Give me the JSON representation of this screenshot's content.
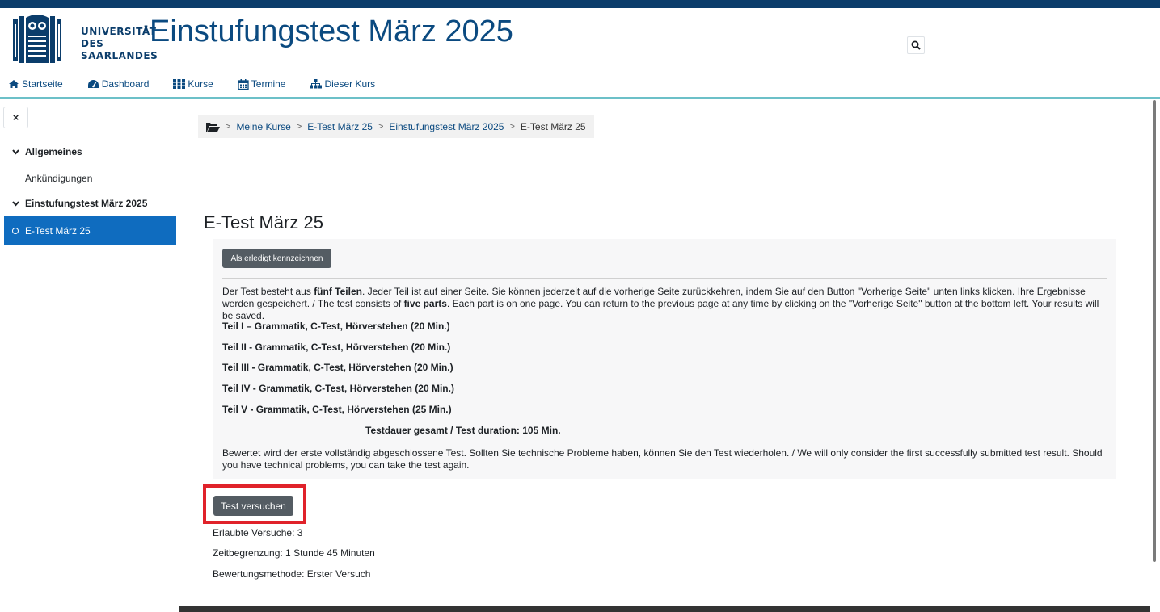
{
  "header": {
    "logo_text": [
      "UNIVERSITÄT",
      "DES",
      "SAARLANDES"
    ],
    "site_title": "Einstufungstest März 2025",
    "search_icon": "search-icon"
  },
  "nav": {
    "items": [
      {
        "label": "Startseite",
        "icon": "home-icon"
      },
      {
        "label": "Dashboard",
        "icon": "dashboard-icon"
      },
      {
        "label": "Kurse",
        "icon": "grid-icon"
      },
      {
        "label": "Termine",
        "icon": "calendar-icon"
      },
      {
        "label": "Dieser Kurs",
        "icon": "sitemap-icon"
      }
    ]
  },
  "sidebar": {
    "close_label": "×",
    "sections": [
      {
        "label": "Allgemeines"
      },
      {
        "label": "Einstufungstest März 2025"
      }
    ],
    "links": [
      {
        "label": "Ankündigungen"
      }
    ],
    "active_item": "E-Test März 25"
  },
  "breadcrumb": {
    "items": [
      "Meine Kurse",
      "E-Test März 25",
      "Einstufungstest März 2025"
    ],
    "current": "E-Test März 25"
  },
  "main": {
    "title": "E-Test März 25",
    "done_button": "Als erledigt kennzeichnen",
    "intro": {
      "p1_a": "Der Test besteht aus ",
      "p1_b": "fünf Teilen",
      "p1_c": ". Jeder Teil ist auf einer Seite. Sie können jederzeit auf die vorherige Seite zurückkehren, indem Sie auf den Button \"Vorherige Seite\" unten links klicken. Ihre Ergebnisse werden gespeichert. / The test consists of ",
      "p1_d": "five parts",
      "p1_e": ". Each part is on one page. You can return to the previous page at any time by clicking on the \"Vorherige Seite\" button at the bottom left. Your results will be saved.",
      "parts": [
        "Teil I – Grammatik, C-Test, Hörverstehen (20 Min.)",
        "Teil II - Grammatik, C-Test, Hörverstehen (20 Min.)",
        "Teil III - Grammatik, C-Test, Hörverstehen (20 Min.)",
        "Teil IV - Grammatik, C-Test, Hörverstehen (20 Min.)",
        "Teil V - Grammatik, C-Test, Hörverstehen (25 Min.)"
      ],
      "duration": "Testdauer gesamt / Test duration: 105 Min.",
      "note": "Bewertet wird der erste vollständig abgeschlossene Test. Sollten Sie technische Probleme haben, können Sie den Test wiederholen. / We will only consider the first successfully submitted test result. Should you have technical problems, you can take the test again."
    },
    "attempt_button": "Test versuchen",
    "meta": {
      "attempts": "Erlaubte Versuche: 3",
      "time_limit": "Zeitbegrenzung: 1 Stunde 45 Minuten",
      "grading": "Bewertungsmethode: Erster Versuch"
    }
  },
  "colors": {
    "brand": "#0b3d6b",
    "link": "#0b4a80",
    "active": "#0f6cbf",
    "highlight": "#e0222a",
    "button": "#545c63"
  }
}
